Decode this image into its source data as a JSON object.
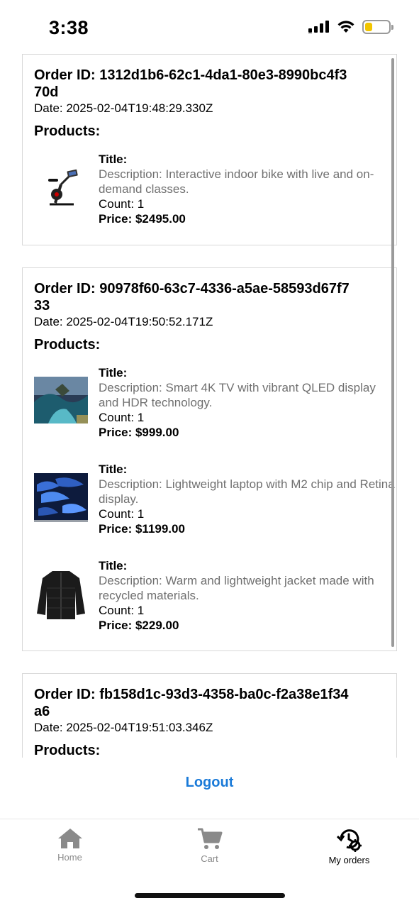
{
  "status": {
    "time": "3:38",
    "battery_color": "#f2c500"
  },
  "orders": [
    {
      "id_text": "Order ID: 1312d1b6-62c1-4da1-80e3-8990bc4f370d",
      "date_text": "Date: 2025-02-04T19:48:29.330Z",
      "products_heading": "Products:",
      "products": [
        {
          "image_icon": "exercise-bike-image",
          "title": "Title:",
          "description": "Description: Interactive indoor bike with live and on-demand classes.",
          "count": "Count: 1",
          "price": "Price: $2495.00"
        }
      ]
    },
    {
      "id_text": "Order ID: 90978f60-63c7-4336-a5ae-58593d67f733",
      "date_text": "Date: 2025-02-04T19:50:52.171Z",
      "products_heading": "Products:",
      "products": [
        {
          "image_icon": "tv-image",
          "title": "Title:",
          "description": "Description: Smart 4K TV with vibrant QLED display and HDR technology.",
          "count": "Count: 1",
          "price": "Price: $999.00"
        },
        {
          "image_icon": "laptop-image",
          "title": "Title:",
          "description": "Description: Lightweight laptop with M2 chip and Retina display.",
          "count": "Count: 1",
          "price": "Price: $1199.00"
        },
        {
          "image_icon": "jacket-image",
          "title": "Title:",
          "description": "Description: Warm and lightweight jacket made with recycled materials.",
          "count": "Count: 1",
          "price": "Price: $229.00"
        }
      ]
    },
    {
      "id_text": "Order ID: fb158d1c-93d3-4358-ba0c-f2a38e1f34a6",
      "date_text": "Date: 2025-02-04T19:51:03.346Z",
      "products_heading": "Products:"
    }
  ],
  "logout_label": "Logout",
  "accent_color": "#1a7ad8",
  "tabs": [
    {
      "label": "Home",
      "icon": "home-icon",
      "active": false
    },
    {
      "label": "Cart",
      "icon": "cart-icon",
      "active": false
    },
    {
      "label": "My orders",
      "icon": "orders-history-icon",
      "active": true
    }
  ]
}
